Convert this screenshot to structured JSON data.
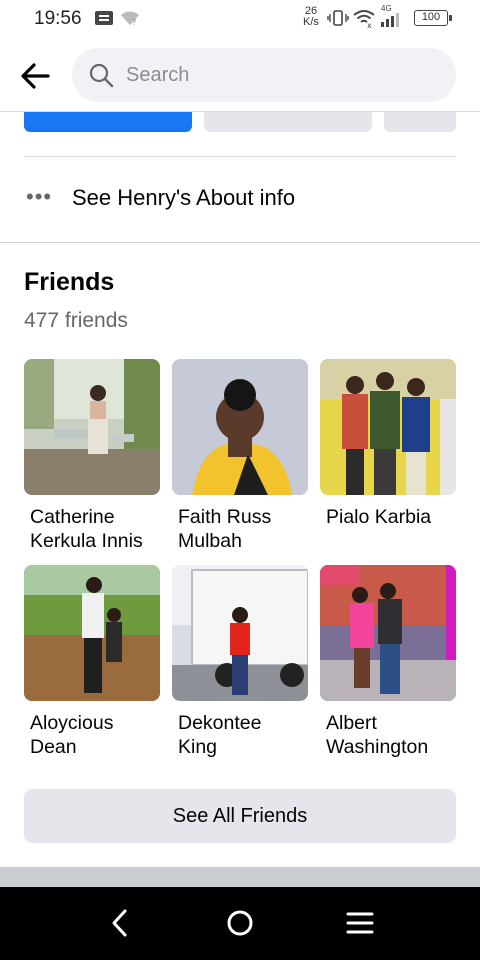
{
  "status_bar": {
    "time": "19:56",
    "speed_value": "26",
    "speed_unit": "K/s",
    "network": "4G",
    "battery": "100",
    "icons": [
      "message-icon",
      "wifi-question-icon",
      "vibrate-icon",
      "wifi-icon",
      "signal-icon",
      "battery-icon"
    ]
  },
  "header": {
    "back_icon": "arrow-left-icon",
    "search_placeholder": "Search",
    "search_value": ""
  },
  "about": {
    "icon": "more-dots-icon",
    "label": "See Henry's About info"
  },
  "friends": {
    "title": "Friends",
    "count_text": "477 friends",
    "items": [
      {
        "first": "Catherine",
        "second": "Kerkula Innis"
      },
      {
        "first": "Faith Russ",
        "second": "Mulbah"
      },
      {
        "first": "Pialo Karbia",
        "second": ""
      },
      {
        "first": "Aloycious",
        "second": "Dean"
      },
      {
        "first": "Dekontee",
        "second": "King"
      },
      {
        "first": "Albert",
        "second": "Washington"
      }
    ],
    "see_all_label": "See All Friends"
  },
  "nav": {
    "back": "nav-back-icon",
    "home": "nav-home-icon",
    "menu": "nav-menu-icon"
  },
  "colors": {
    "accent": "#1877f2",
    "button_gray": "#e4e6eb",
    "secondary_text": "#65676b"
  }
}
